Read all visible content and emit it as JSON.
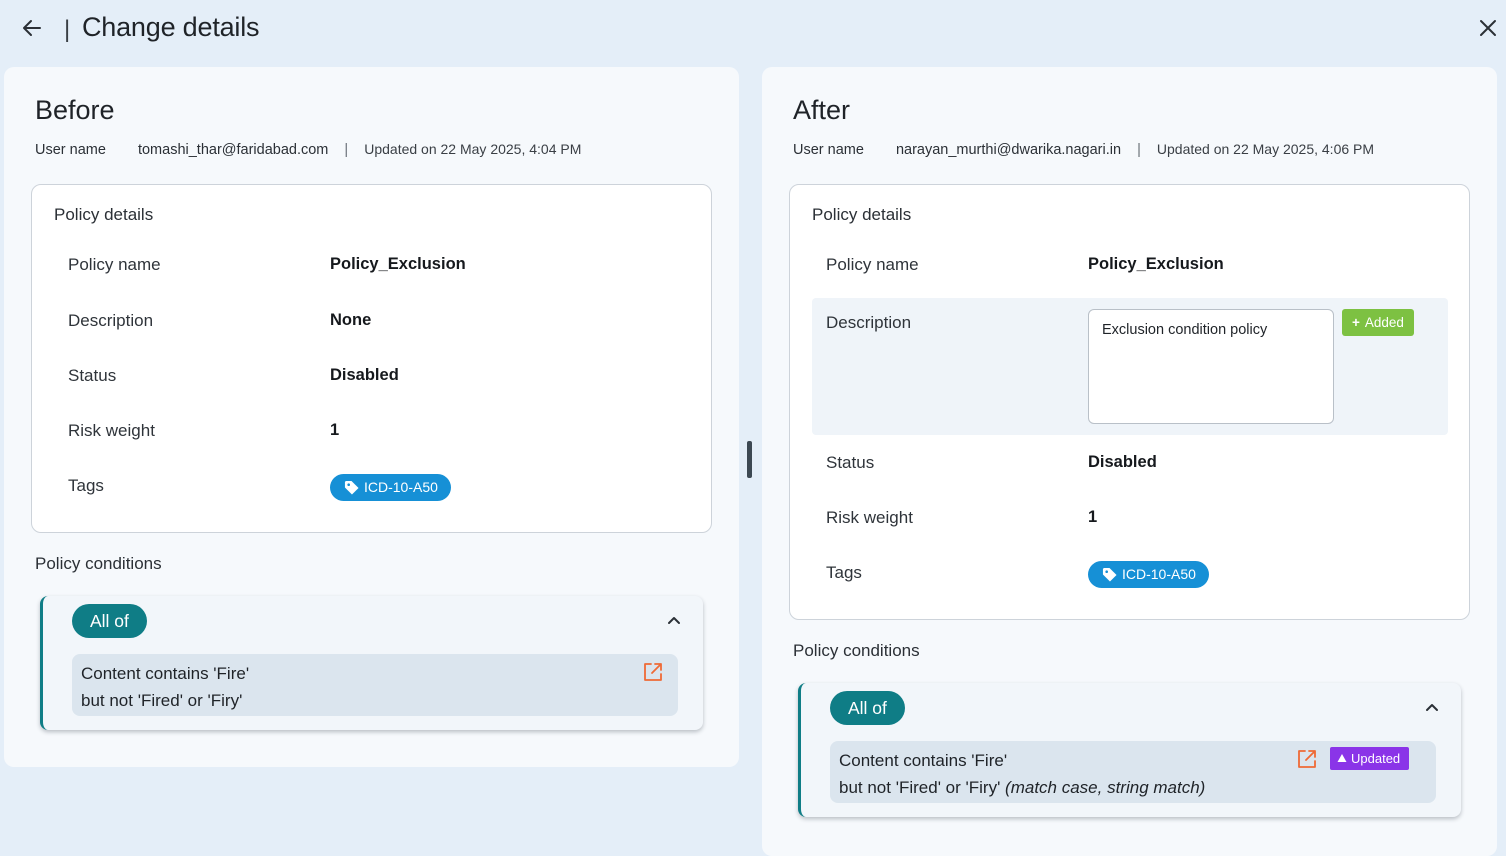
{
  "header": {
    "title": "Change details",
    "separator": "|",
    "back_icon": "arrow-left-icon",
    "close_icon": "close-icon"
  },
  "before": {
    "title": "Before",
    "user_label": "User name",
    "user_email": "tomashi_thar@faridabad.com",
    "divider": "|",
    "updated": "Updated on 22 May 2025, 4:04 PM",
    "policy_details": {
      "title": "Policy details",
      "rows": [
        {
          "label": "Policy name",
          "value": "Policy_Exclusion"
        },
        {
          "label": "Description",
          "value": "None"
        },
        {
          "label": "Status",
          "value": "Disabled"
        },
        {
          "label": "Risk weight",
          "value": "1"
        },
        {
          "label": "Tags",
          "tag": "ICD-10-A50"
        }
      ]
    },
    "conditions": {
      "title": "Policy conditions",
      "group": "All of",
      "line1": "Content contains 'Fire'",
      "line2": "but not 'Fired' or 'Firy'"
    }
  },
  "after": {
    "title": "After",
    "user_label": "User name",
    "user_email": "narayan_murthi@dwarika.nagari.in",
    "divider": "|",
    "updated": "Updated on 22 May 2025, 4:06 PM",
    "policy_details": {
      "title": "Policy details",
      "rows": [
        {
          "label": "Policy name",
          "value": "Policy_Exclusion"
        },
        {
          "label": "Description",
          "value": "Exclusion condition policy",
          "badge": "Added",
          "badge_color": "#7dc142"
        },
        {
          "label": "Status",
          "value": "Disabled"
        },
        {
          "label": "Risk weight",
          "value": "1"
        },
        {
          "label": "Tags",
          "tag": "ICD-10-A50"
        }
      ]
    },
    "conditions": {
      "title": "Policy conditions",
      "group": "All of",
      "line1": "Content contains 'Fire'",
      "line2": "but not 'Fired' or 'Firy'",
      "line2_extra": "(match case, string match)",
      "badge": "Updated",
      "badge_color": "#8a34e8"
    }
  },
  "colors": {
    "accent_teal": "#0f7d86",
    "tag_blue": "#1690d6",
    "added_green": "#7dc142",
    "updated_purple": "#8a34e8",
    "open_icon_orange": "#ef6a36"
  }
}
